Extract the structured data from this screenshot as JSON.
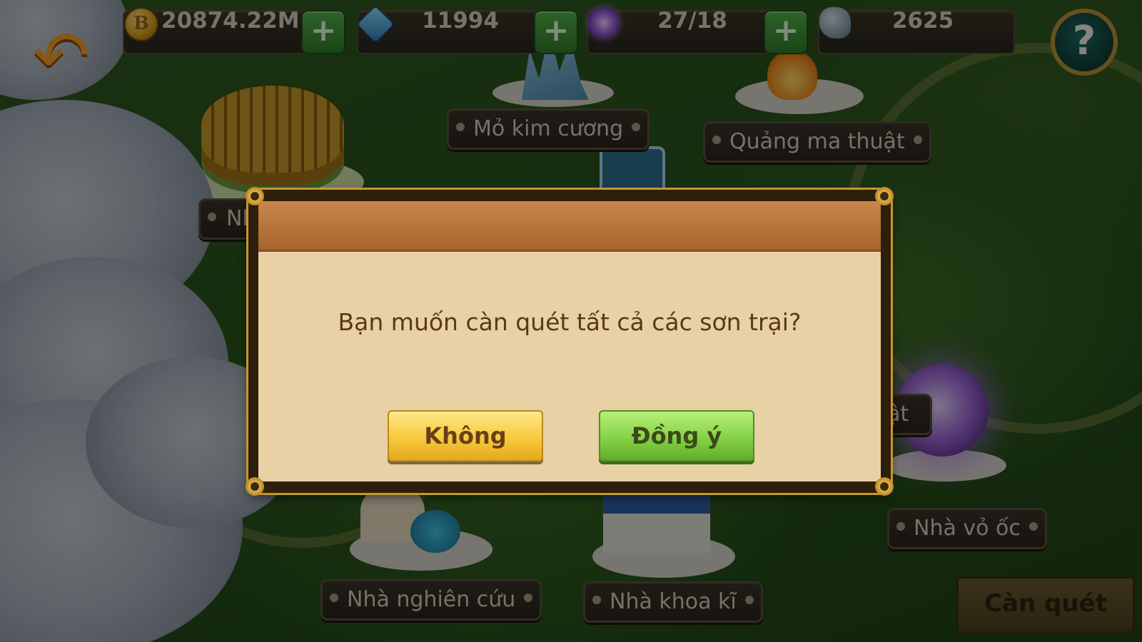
{
  "resources": {
    "gold": "20874.22M",
    "gems": "11994",
    "energy": "27/18",
    "stone": "2625"
  },
  "icons": {
    "back": "back-arrow-icon",
    "help": "help-icon",
    "gold": "gold-coin-icon",
    "gems": "blue-gem-icon",
    "energy": "purple-swirl-icon",
    "stone": "stone-icon",
    "plus": "plus-icon"
  },
  "help_symbol": "?",
  "back_symbol": "↶",
  "plus_symbol": "+",
  "map_labels": {
    "diamond_mine": "Mỏ kim cương",
    "magic_square": "Quảng ma thuật",
    "partial_left_top": "Nh",
    "partial_right": "ật",
    "shell_house": "Nhà vỏ ốc",
    "research_house": "Nhà nghiên cứu",
    "tech_house": "Nhà khoa kĩ"
  },
  "sweep_button": "Càn quét",
  "modal": {
    "message": "Bạn muốn càn quét tất cả các sơn trại?",
    "no_label": "Không",
    "yes_label": "Đồng ý"
  },
  "colors": {
    "modal_body": "#e8d1a4",
    "modal_header": "#b8733a",
    "no_button": "#f7c93c",
    "yes_button": "#86d146"
  }
}
